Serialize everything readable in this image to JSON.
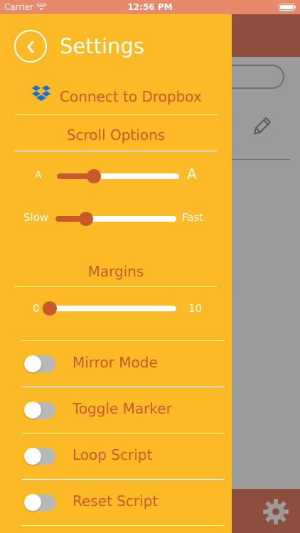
{
  "status_bar": {
    "carrier": "Carrier",
    "time": "12:56 PM"
  },
  "drawer": {
    "title": "Settings",
    "dropbox_label": "Connect to Dropbox",
    "scroll_options_label": "Scroll Options",
    "font_size_slider": {
      "min_label": "A",
      "max_label": "A",
      "value_fraction": 0.3
    },
    "speed_slider": {
      "min_label": "Slow",
      "max_label": "Fast",
      "value_fraction": 0.25
    },
    "margins_label": "Margins",
    "margins_slider": {
      "min_label": "0",
      "max_label": "10",
      "value": 0
    },
    "toggles": [
      {
        "label": "Mirror Mode",
        "on": false
      },
      {
        "label": "Toggle Marker",
        "on": false
      },
      {
        "label": "Loop Script",
        "on": false
      },
      {
        "label": "Reset Script",
        "on": false
      }
    ]
  },
  "colors": {
    "drawer_bg": "#fcba26",
    "accent": "#c9582a",
    "header_bg": "#8e4e3f",
    "content_bg": "#9b9b9b",
    "toggle_off": "#b8b8b8"
  },
  "icons": [
    "wifi-icon",
    "battery-icon",
    "back-chevron-icon",
    "dropbox-icon",
    "pencil-icon",
    "gear-icon"
  ]
}
